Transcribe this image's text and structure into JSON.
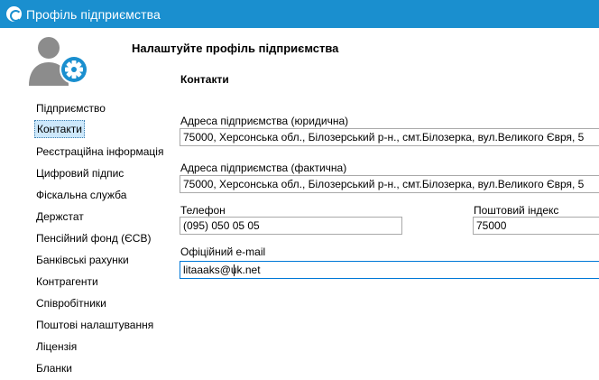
{
  "window": {
    "title": "Профіль підприємства"
  },
  "page": {
    "heading": "Налаштуйте профіль підприємства",
    "section": "Контакти"
  },
  "nav": {
    "items": [
      "Підприємство",
      "Контакти",
      "Реєстраційна інформація",
      "Цифровий підпис",
      "Фіскальна служба",
      "Держстат",
      "Пенсійний фонд (ЄСВ)",
      "Банківські рахунки",
      "Контрагенти",
      "Співробітники",
      "Поштові налаштування",
      "Ліцензія",
      "Бланки"
    ],
    "active_index": 1
  },
  "form": {
    "legal_address": {
      "label": "Адреса підприємства (юридична)",
      "value": "75000, Херсонська обл., Білозерський р-н., смт.Білозерка, вул.Великого Євря, 5"
    },
    "actual_address": {
      "label": "Адреса підприємства (фактична)",
      "value": "75000, Херсонська обл., Білозерський р-н., смт.Білозерка, вул.Великого Євря, 5"
    },
    "phone": {
      "label": "Телефон",
      "value": "(095) 050 05 05"
    },
    "postal_code": {
      "label": "Поштовий індекс",
      "value": "75000"
    },
    "email": {
      "label": "Офіційний e-mail",
      "value": "litaaaks@uk.net"
    }
  },
  "colors": {
    "titlebar": "#1a8fcf",
    "avatar_gray": "#8c8c8c",
    "gear_blue": "#1a8fcf",
    "nav_selected": "#cde8fb",
    "input_border": "#a9a9a9",
    "input_focus_border": "#0078d7"
  }
}
